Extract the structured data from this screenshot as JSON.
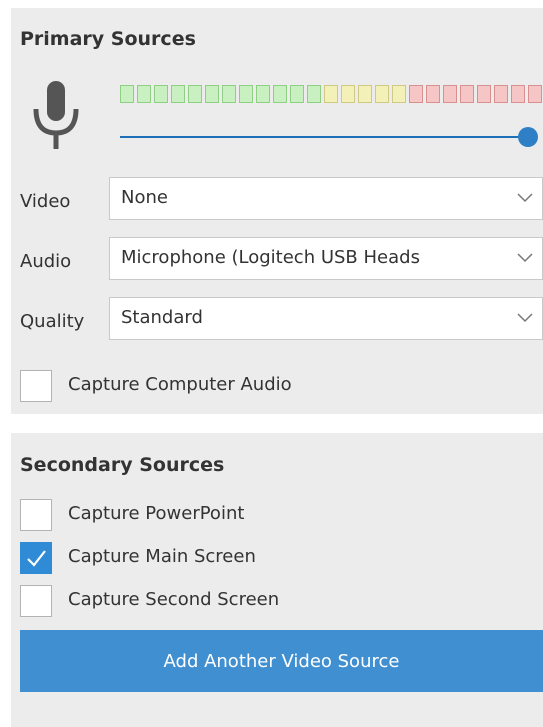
{
  "primary": {
    "title": "Primary Sources",
    "mic_icon": "microphone-icon",
    "level_meter": {
      "colors": {
        "green_fill": "#c8f0c0",
        "green_border": "#8fcf84",
        "yellow_fill": "#f4f1b8",
        "yellow_border": "#cfc983",
        "red_fill": "#f6c6c6",
        "red_border": "#d99090"
      },
      "cells": [
        "green",
        "green",
        "green",
        "green",
        "green",
        "green",
        "green",
        "green",
        "green",
        "green",
        "green",
        "green",
        "yellow",
        "yellow",
        "yellow",
        "yellow",
        "yellow",
        "red",
        "red",
        "red",
        "red",
        "red",
        "red",
        "red",
        "red"
      ]
    },
    "volume_level": 1.0,
    "video": {
      "label": "Video",
      "value": "None"
    },
    "audio": {
      "label": "Audio",
      "value": "Microphone (Logitech USB Heads"
    },
    "quality": {
      "label": "Quality",
      "value": "Standard"
    },
    "capture_computer_audio": {
      "label": "Capture Computer Audio",
      "checked": false
    }
  },
  "secondary": {
    "title": "Secondary Sources",
    "options": [
      {
        "label": "Capture PowerPoint",
        "checked": false
      },
      {
        "label": "Capture Main Screen",
        "checked": true
      },
      {
        "label": "Capture Second Screen",
        "checked": false
      }
    ],
    "add_button_label": "Add Another Video Source"
  },
  "colors": {
    "accent": "#3f8fd1",
    "panel_bg": "#ececec",
    "text": "#333333"
  }
}
